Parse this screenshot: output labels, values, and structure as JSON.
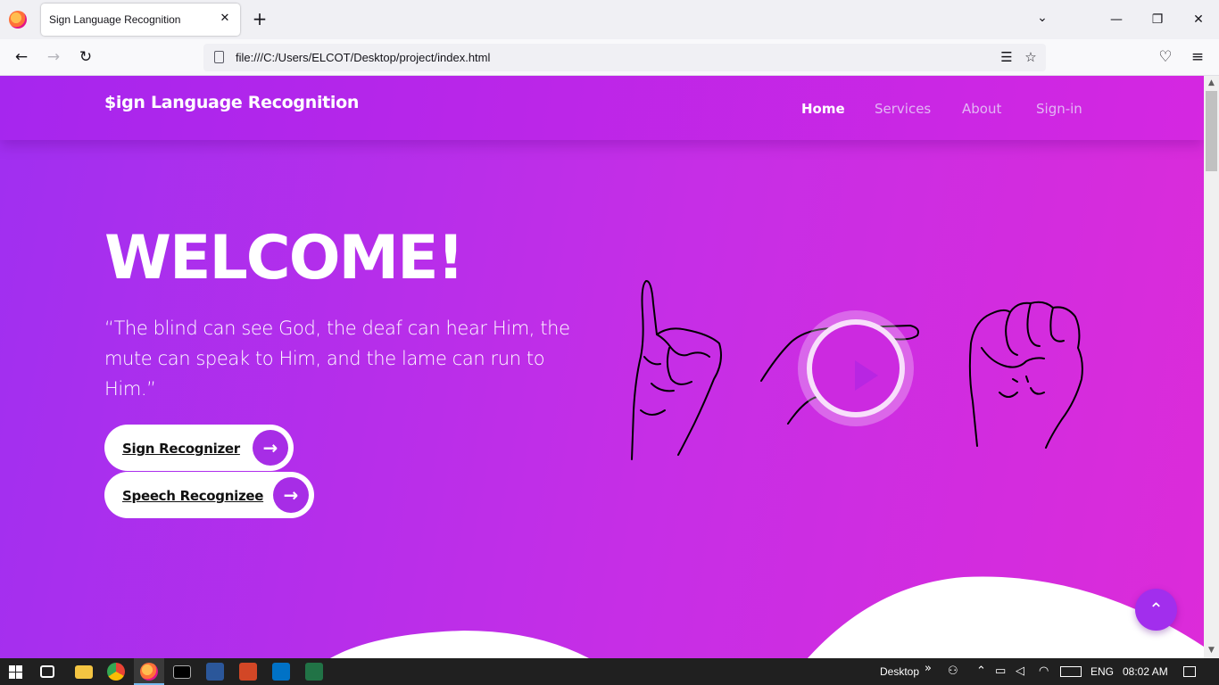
{
  "browser": {
    "tab_title": "Sign Language Recognition",
    "tab_close": "✕",
    "new_tab": "+",
    "list_all_tabs": "⌄",
    "url": "file:///C:/Users/ELCOT/Desktop/project/index.html",
    "window_controls": {
      "minimize": "—",
      "restore": "❐",
      "close": "✕"
    },
    "nav": {
      "back": "←",
      "forward": "→",
      "reload": "↻"
    },
    "url_icons": {
      "reader": "☰",
      "bookmark": "☆"
    },
    "toolbar_icons": {
      "pocket": "♡",
      "menu": "≡"
    }
  },
  "site": {
    "brand": "$ign Language Recognition",
    "menu": [
      {
        "label": "Home",
        "active": true
      },
      {
        "label": "Services",
        "active": false
      },
      {
        "label": "About",
        "active": false
      },
      {
        "label": "Sign-in",
        "active": false
      }
    ],
    "hero": {
      "title": "WELCOME!",
      "quote": "“The blind can see God, the deaf can hear Him, the mute can speak to Him, and the lame can run to Him.”"
    },
    "buttons": [
      {
        "label": "Sign Recognizer",
        "arrow": "→"
      },
      {
        "label": "Speech Recognizee",
        "arrow": "→"
      }
    ],
    "back_to_top": "⌃",
    "colors": {
      "gradient_start": "#a02ff0",
      "gradient_end": "#dc2bd9",
      "accent": "#a72de6"
    }
  },
  "taskbar": {
    "desktop_label": "Desktop",
    "chevron": "»",
    "language": "ENG",
    "time": "08:02 AM",
    "apps": [
      "windows-start-icon",
      "task-view-icon",
      "file-explorer-icon",
      "chrome-icon",
      "firefox-icon",
      "command-prompt-icon",
      "word-icon",
      "powerpoint-icon",
      "outlook-icon",
      "excel-icon"
    ]
  }
}
